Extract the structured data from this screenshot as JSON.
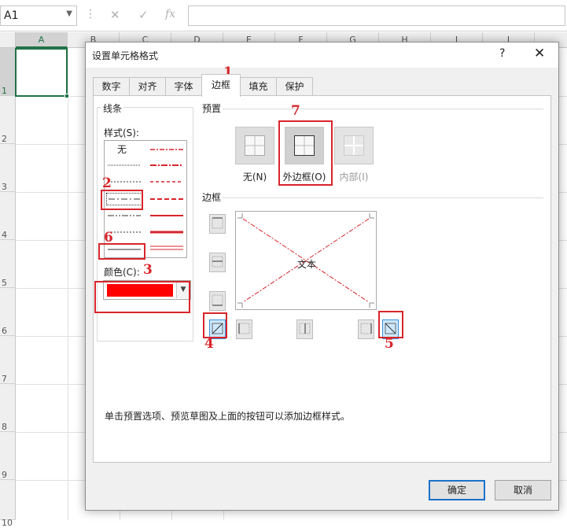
{
  "formula_bar": {
    "name_box": "A1",
    "cancel_icon": "✕",
    "enter_icon": "✓",
    "fx_label": "fx"
  },
  "sheet": {
    "selected_column": "A",
    "columns": [
      "A",
      "B",
      "C",
      "D",
      "E",
      "F",
      "G",
      "H",
      "I",
      "J"
    ],
    "rows": [
      "1",
      "2",
      "3",
      "4",
      "5",
      "6",
      "7",
      "8",
      "9",
      "10"
    ]
  },
  "dialog": {
    "title": "设置单元格格式",
    "help": "?",
    "close": "✕",
    "tabs": [
      "数字",
      "对齐",
      "字体",
      "边框",
      "填充",
      "保护"
    ],
    "active_tab": "边框",
    "line_group": {
      "title": "线条",
      "style_label": "样式(S):",
      "none_label": "无",
      "color_label": "颜色(C):",
      "color_value": "#ff0000"
    },
    "presets_group": {
      "title": "预置",
      "items": [
        {
          "label": "无(N)"
        },
        {
          "label": "外边框(O)"
        },
        {
          "label": "内部(I)"
        }
      ]
    },
    "border_group": {
      "title": "边框",
      "preview_text": "文本",
      "line_color": "#d8252b"
    },
    "hint": "单击预置选项、预览草图及上面的按钮可以添加边框样式。",
    "ok": "确定",
    "cancel": "取消"
  },
  "annotations": [
    "1",
    "2",
    "3",
    "4",
    "5",
    "6",
    "7"
  ]
}
